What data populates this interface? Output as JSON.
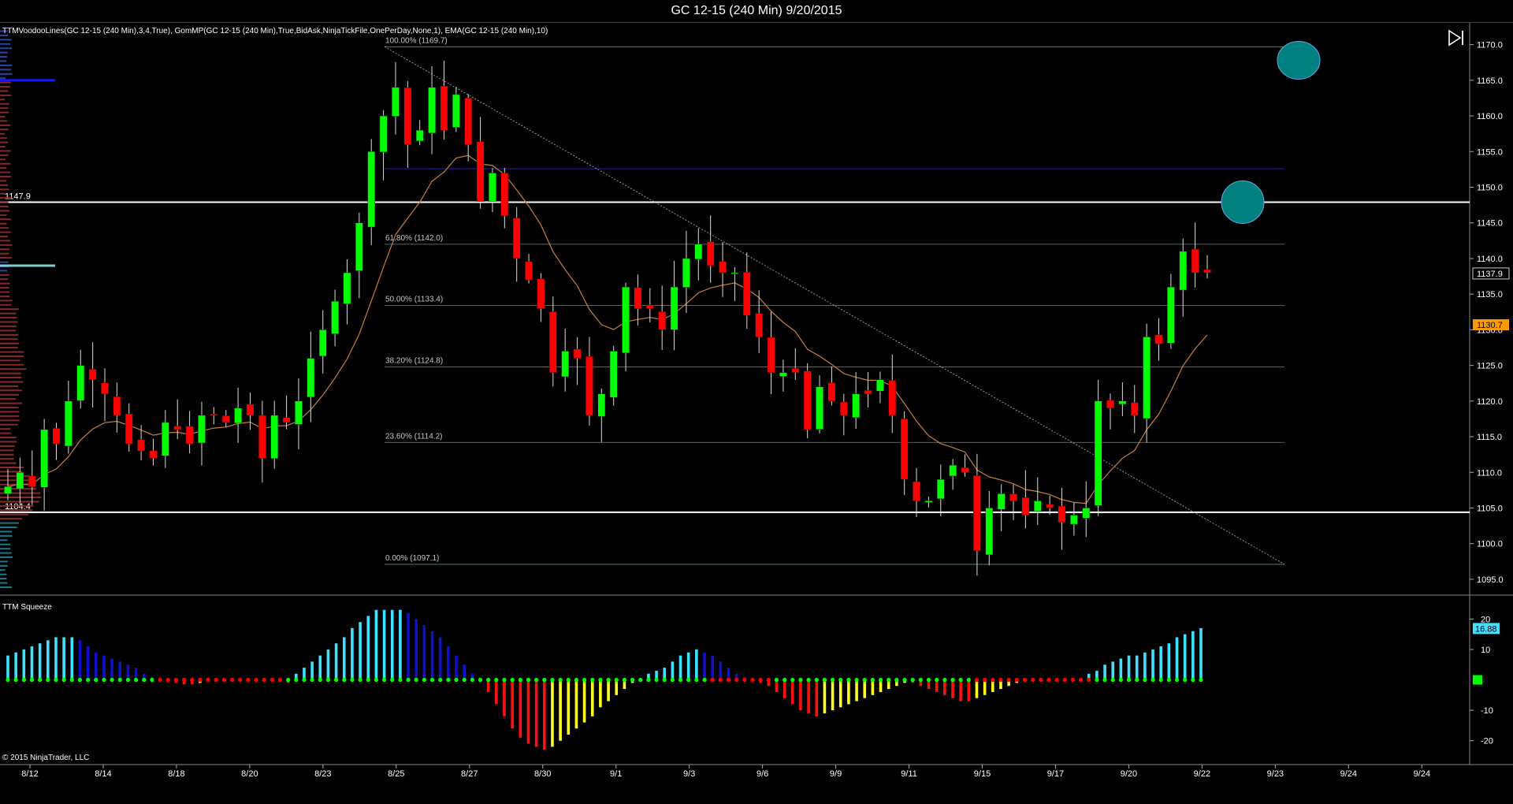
{
  "window": {
    "title": "GC 12-15 (240 Min)  9/20/2015",
    "copyright": "© 2015 NinjaTrader, LLC"
  },
  "price_panel": {
    "indicator_label": "TTMVoodooLines(GC 12-15 (240 Min),3,4,True), GomMP(GC 12-15 (240 Min),True,BidAsk,NinjaTickFile,OnePerDay,None,1), EMA(GC 12-15 (240 Min),10)",
    "left_level_labels": [
      "1147.9",
      "1104.4"
    ],
    "last_price_label": "1137.9",
    "ema_value_label": "1130.7"
  },
  "squeeze_panel": {
    "label": "TTM Squeeze",
    "value_label": "16.88"
  },
  "colors": {
    "up_candle": "#00ff00",
    "down_candle": "#ff0000",
    "ema": "#c8803c",
    "fib": "#7ecfcf",
    "voodoo_line": "#ffffff",
    "squeeze_pos_rising": "#40e0ff",
    "squeeze_pos_falling": "#1010c8",
    "squeeze_neg_falling": "#ff1010",
    "squeeze_neg_rising": "#ffff20",
    "squeeze_dot_off": "#00ff00",
    "squeeze_dot_on": "#ff0000",
    "target_circle": "#008080"
  },
  "chart_data": [
    {
      "type": "candlestick",
      "title": "GC 12-15 (240 Min)  9/20/2015",
      "x_tick_labels": [
        "8/12",
        "8/14",
        "8/18",
        "8/20",
        "8/23",
        "8/25",
        "8/27",
        "8/30",
        "9/1",
        "9/3",
        "9/6",
        "9/9",
        "9/11",
        "9/15",
        "9/17",
        "9/20",
        "9/22",
        "9/23",
        "9/24",
        "9/24"
      ],
      "y_ticks": [
        1095.0,
        1100.0,
        1105.0,
        1110.0,
        1115.0,
        1120.0,
        1125.0,
        1130.0,
        1135.0,
        1140.0,
        1145.0,
        1150.0,
        1155.0,
        1160.0,
        1165.0,
        1170.0
      ],
      "ylim": [
        1093.0,
        1172.5
      ],
      "horizontal_levels": [
        1147.9,
        1104.4
      ],
      "fibonacci": [
        {
          "label": "100.00% (1169.7)",
          "value": 1169.7
        },
        {
          "label": "61.80% (1142.0)",
          "value": 1142.0
        },
        {
          "label": "50.00% (1133.4)",
          "value": 1133.4
        },
        {
          "label": "38.20% (1124.8)",
          "value": 1124.8
        },
        {
          "label": "23.60% (1114.2)",
          "value": 1114.2
        },
        {
          "label": "0.00% (1097.1)",
          "value": 1097.1
        }
      ],
      "last_price": 1137.9,
      "ema_last": 1130.7,
      "key_points": [
        1108,
        1110,
        1108,
        1116,
        1114,
        1120,
        1125,
        1123,
        1121,
        1118,
        1114,
        1113,
        1112,
        1117,
        1116,
        1114,
        1118,
        1118,
        1117,
        1119,
        1118,
        1112,
        1118,
        1117,
        1120,
        1126,
        1130,
        1134,
        1138,
        1145,
        1155,
        1160,
        1164,
        1156,
        1158,
        1164,
        1158,
        1163,
        1156,
        1148,
        1152,
        1146,
        1140,
        1137,
        1133,
        1124,
        1127,
        1126,
        1118,
        1121,
        1127,
        1136,
        1133,
        1133,
        1130,
        1136,
        1140,
        1142,
        1139,
        1138,
        1138,
        1132,
        1129,
        1124,
        1124,
        1124,
        1116,
        1122,
        1120,
        1118,
        1121,
        1121,
        1123,
        1118,
        1109,
        1106,
        1106,
        1109,
        1111,
        1110,
        1099,
        1105,
        1107,
        1106,
        1104,
        1106,
        1105,
        1103,
        1104,
        1105,
        1120,
        1119,
        1120,
        1118,
        1129,
        1128,
        1136,
        1141,
        1138,
        1138
      ]
    },
    {
      "type": "bar",
      "title": "TTM Squeeze",
      "y_ticks": [
        -20,
        -10,
        10,
        20
      ],
      "ylim": [
        -25,
        25
      ],
      "last_value": 16.88,
      "values": [
        8,
        9,
        10,
        11,
        12,
        13,
        14,
        14,
        14,
        13,
        11,
        9,
        8,
        7,
        6,
        5,
        4,
        2,
        1,
        0,
        -0.5,
        -1,
        -1.5,
        -1.5,
        -1,
        -0.5,
        0,
        0,
        0,
        0,
        0,
        0,
        0,
        0,
        -0.5,
        -1,
        2,
        4,
        6,
        8,
        10,
        12,
        14,
        17,
        19,
        21,
        23,
        23,
        23,
        23,
        22,
        20,
        18,
        16,
        14,
        11,
        8,
        5,
        2,
        0,
        -4,
        -8,
        -12,
        -16,
        -19,
        -21,
        -22,
        -23,
        -22,
        -20,
        -18,
        -16,
        -14,
        -12,
        -9,
        -7,
        -5,
        -3,
        -1,
        0,
        2,
        3,
        4,
        6,
        8,
        9,
        10,
        9,
        8,
        6,
        4,
        2,
        1,
        0,
        -1,
        -2,
        -4,
        -6,
        -8,
        -10,
        -11,
        -12,
        -11,
        -10,
        -9,
        -8,
        -7,
        -6,
        -5,
        -4,
        -3,
        -2,
        -1,
        -1,
        -2,
        -3,
        -4,
        -5,
        -6,
        -7,
        -7,
        -6,
        -5,
        -4,
        -3,
        -2,
        -1,
        -0.5,
        -0.5,
        -0.5,
        0,
        0,
        0,
        0,
        0,
        2,
        3,
        5,
        6,
        7,
        8,
        8,
        9,
        10,
        11,
        12,
        14,
        15,
        16,
        17
      ]
    }
  ]
}
